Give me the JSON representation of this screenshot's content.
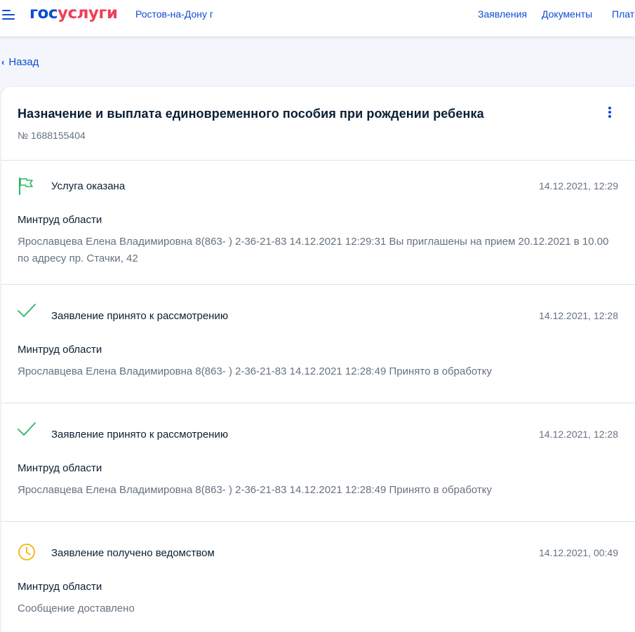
{
  "header": {
    "logo_part1": "гос",
    "logo_part2": "услуги",
    "region": "Ростов-на-Дону г",
    "nav": [
      "Заявления",
      "Документы",
      "Плат"
    ]
  },
  "back_label": "Назад",
  "application": {
    "title": "Назначение и выплата единовременного пособия при рождении ребенка",
    "number": "№ 1688155404"
  },
  "events": [
    {
      "icon": "flag-icon",
      "status": "Услуга оказана",
      "date": "14.12.2021, 12:29",
      "org": "Минтруд области",
      "message": "Ярославцева Елена Владимировна 8(863- ) 2-36-21-83 14.12.2021 12:29:31 Вы приглашены на прием 20.12.2021 в 10.00 по адресу пр. Стачки, 42"
    },
    {
      "icon": "check-icon",
      "status": "Заявление принято к рассмотрению",
      "date": "14.12.2021, 12:28",
      "org": "Минтруд области",
      "message": "Ярославцева Елена Владимировна 8(863- ) 2-36-21-83 14.12.2021 12:28:49 Принято в обработку"
    },
    {
      "icon": "check-icon",
      "status": "Заявление принято к рассмотрению",
      "date": "14.12.2021, 12:28",
      "org": "Минтруд области",
      "message": "Ярославцева Елена Владимировна 8(863- ) 2-36-21-83 14.12.2021 12:28:49 Принято в обработку"
    },
    {
      "icon": "clock-icon",
      "status": "Заявление получено ведомством",
      "date": "14.12.2021, 00:49",
      "org": "Минтруд области",
      "message": "Сообщение доставлено"
    }
  ],
  "colors": {
    "brand_blue": "#0d4cd3",
    "brand_red": "#ee3f58",
    "success_green": "#2bb565",
    "pending_yellow": "#f5b300",
    "muted_text": "#66727f"
  }
}
